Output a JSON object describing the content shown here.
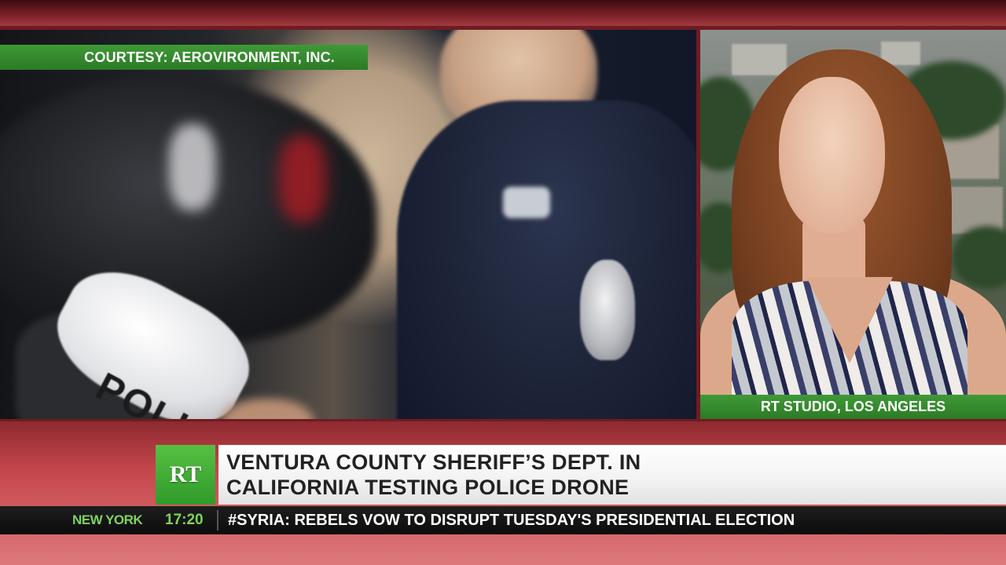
{
  "footage": {
    "courtesy_label": "COURTESY: AEROVIRONMENT, INC.",
    "drone_lettering": "POLIC"
  },
  "studio": {
    "location_label": "RT STUDIO, LOS ANGELES"
  },
  "lower_third": {
    "logo_text": "RT",
    "headline_line1": "VENTURA COUNTY SHERIFF’S DEPT. IN",
    "headline_line2": "CALIFORNIA TESTING POLICE DRONE"
  },
  "ticker": {
    "city": "NEW YORK",
    "time": "17:20",
    "hashtag": "#SYRIA:",
    "headline": "REBELS VOW TO DISRUPT TUESDAY'S PRESIDENTIAL ELECTION"
  },
  "colors": {
    "brand_green": "#3f9a36",
    "brand_red": "#c5474c",
    "ticker_green": "#7ed35d"
  }
}
